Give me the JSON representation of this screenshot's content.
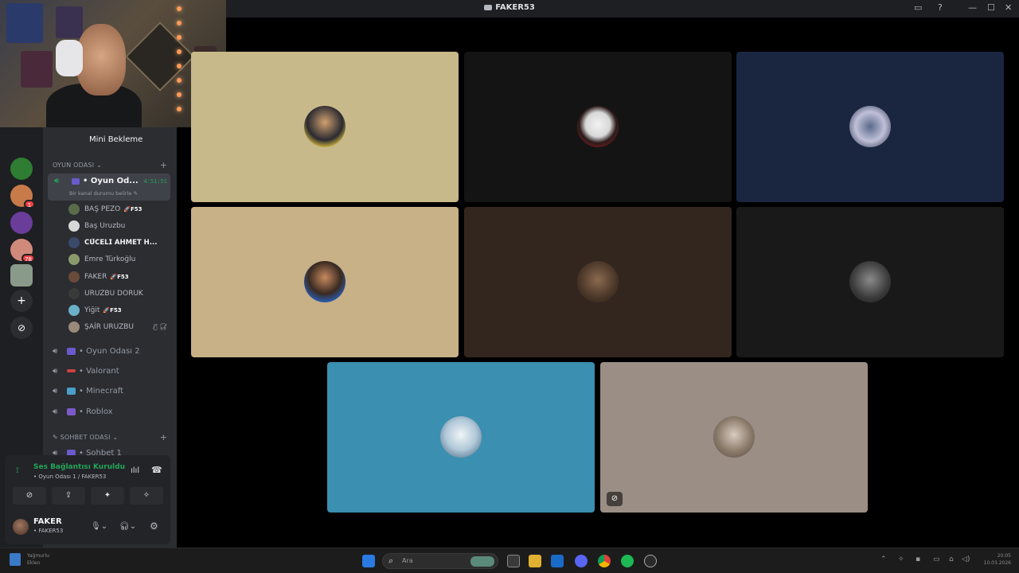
{
  "window": {
    "title": "FAKER53",
    "controls": {
      "inbox_icon": "▭",
      "help_icon": "?",
      "minimize": "—",
      "maximize": "☐",
      "close": "✕"
    }
  },
  "servers": {
    "items": [
      {
        "name": "server-1",
        "color": "#2e7d32",
        "badge": ""
      },
      {
        "name": "server-2",
        "color": "#c77a4a",
        "badge": "1"
      },
      {
        "name": "server-3",
        "color": "#6a3d9a",
        "badge": ""
      },
      {
        "name": "server-4",
        "color": "#d08a7a",
        "badge": "78"
      },
      {
        "name": "server-5",
        "color": "#8a9a8a",
        "badge": ""
      }
    ],
    "add_icon": "+",
    "discover_icon": "⊘"
  },
  "channel_sidebar": {
    "server_name": "Mini Bekleme",
    "category_game": "OYUN ODASI",
    "category_chat": "SOHBET ODASI",
    "active_channel": {
      "name": "• Oyun Od...",
      "timer": "4:51:51",
      "status_hint": "Bir kanal durumu belirle ✎"
    },
    "members": [
      {
        "name": "BAŞ PEZO",
        "tag": "🚀F53",
        "color": "#5a6b4a"
      },
      {
        "name": "Baş Uruzbu",
        "tag": "",
        "color": "#d8d8d8"
      },
      {
        "name": "𝗖𝗨̈𝗖𝗘𝗟𝗜 𝗔𝗛𝗠𝗘𝗧 𝗛...",
        "tag": "",
        "color": "#3a4a6a"
      },
      {
        "name": "Emre Türkoğlu",
        "tag": "",
        "color": "#8a9a6a"
      },
      {
        "name": "FAKER",
        "tag": "🚀F53",
        "color": "#6a4a3a"
      },
      {
        "name": "URUZBU DORUK",
        "tag": "",
        "color": "#3a3a3a"
      },
      {
        "name": "Yiğit",
        "tag": "🚀F53",
        "color": "#6ab0c8"
      },
      {
        "name": "ŞAİR URUZBU",
        "tag": "",
        "color": "#9a8a7a",
        "muted": "🎙̸ 🎧̸"
      }
    ],
    "voice_channels": [
      {
        "name": "• Oyun Odası 2",
        "color": "#6a5acd"
      },
      {
        "name": "• Valorant",
        "color": "#d04040"
      },
      {
        "name": "• Minecraft",
        "color": "#4aa0c8"
      },
      {
        "name": "• Roblox",
        "color": "#7a5ac8"
      }
    ],
    "chat_channel": "• Sohbet 1"
  },
  "user_panel": {
    "connection_title": "Ses Bağlantısı Kuruldu",
    "connection_sub": "• Oyun Odası 1 / FAKER53",
    "username": "FAKER",
    "user_status": "• FAKER53",
    "buttons": [
      "⊘",
      "⇪",
      "✦",
      "✧"
    ]
  },
  "video_tiles": [
    {
      "name": "tile-1",
      "bg": "#c8b98a",
      "avatar": "#2a2a30"
    },
    {
      "name": "tile-2",
      "bg": "#141414",
      "avatar": "#e8e8e8"
    },
    {
      "name": "tile-3",
      "bg": "#1a2540",
      "avatar": "#c0c0d8"
    },
    {
      "name": "tile-4",
      "bg": "#c8b087",
      "avatar": "#2a5aa8"
    },
    {
      "name": "tile-5",
      "bg": "#33261e",
      "avatar": "#6a5040"
    },
    {
      "name": "tile-6",
      "bg": "#191919",
      "avatar": "#6a6a6a"
    },
    {
      "name": "tile-7",
      "bg": "#3b8fb0",
      "avatar": "#d8e4ec"
    },
    {
      "name": "tile-8",
      "bg": "#9a8e85",
      "avatar": "#b0a090"
    }
  ],
  "taskbar": {
    "weather_line1": "Yağmurlu",
    "weather_line2": "Eklen",
    "search_placeholder": "Ara",
    "clock_time": "20:05",
    "clock_date": "10.03.2026"
  }
}
